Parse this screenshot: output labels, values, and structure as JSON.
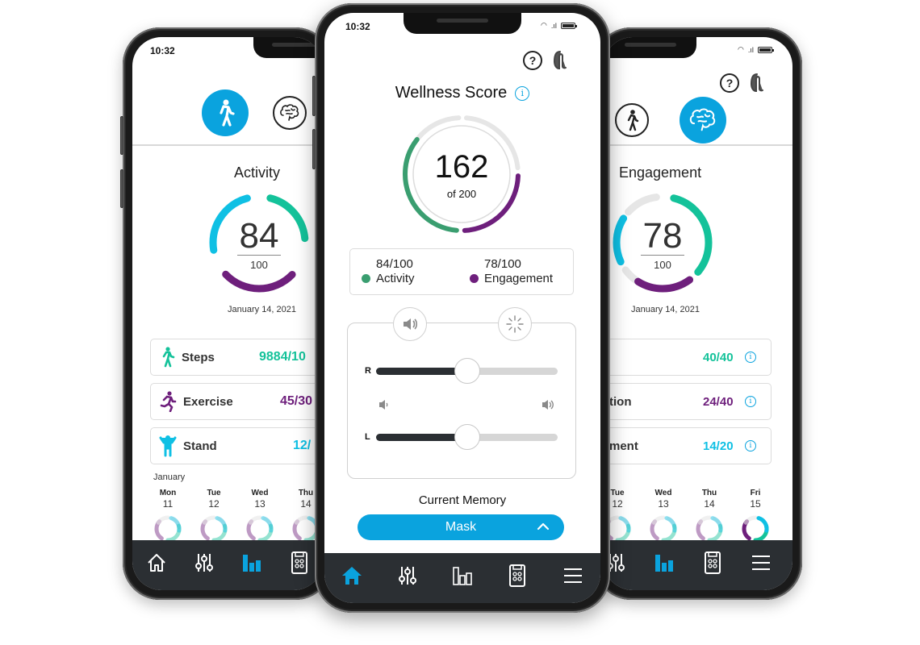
{
  "colors": {
    "accent_blue": "#0aa3de",
    "activity_green": "#3a9e70",
    "teal": "#14c29a",
    "cyan": "#0fc0e4",
    "purple": "#6e1f7c",
    "track_gray": "#e6e6e6",
    "nav_bg": "#2b2f33"
  },
  "status_bar": {
    "time": "10:32"
  },
  "icons": {
    "help": "help-bubble-icon",
    "hearing_aid": "hearing-aid-icon",
    "activity": "walking-person-icon",
    "engagement": "brain-icon",
    "info": "info-icon",
    "volume": "speaker-icon",
    "noise": "sparkle-icon"
  },
  "left_phone": {
    "title": "Activity",
    "score": "84",
    "total": "100",
    "date": "January 14, 2021",
    "ring": {
      "teal_fraction": 0.22,
      "cyan_fraction": 0.26,
      "purple_fraction": 0.28
    },
    "metrics": [
      {
        "label": "Steps",
        "value": "9884/10",
        "color": "#14c29a",
        "icon": "steps-icon"
      },
      {
        "label": "Exercise",
        "value": "45/30",
        "color": "#6e1f7c",
        "icon": "exercise-icon"
      },
      {
        "label": "Stand",
        "value": "12/",
        "color": "#0fc0e4",
        "icon": "stand-icon"
      }
    ],
    "month": "January",
    "days": [
      {
        "name": "Mon",
        "num": "11"
      },
      {
        "name": "Tue",
        "num": "12"
      },
      {
        "name": "Wed",
        "num": "13"
      },
      {
        "name": "Thu",
        "num": "14"
      }
    ]
  },
  "center_phone": {
    "title": "Wellness Score",
    "score": "162",
    "of_label": "of 200",
    "legend": [
      {
        "value": "84/100",
        "label": "Activity",
        "color": "#3a9e70"
      },
      {
        "value": "78/100",
        "label": "Engagement",
        "color": "#6e1f7c"
      }
    ],
    "sliders": [
      {
        "label": "R",
        "value_fraction": 0.5
      },
      {
        "label": "L",
        "value_fraction": 0.5
      }
    ],
    "memory_label": "Current Memory",
    "memory_value": "Mask"
  },
  "right_phone": {
    "title": "Engagement",
    "score": "78",
    "total": "100",
    "date": "January 14, 2021",
    "metrics": [
      {
        "label": "",
        "value": "40/40",
        "color": "#14c29a"
      },
      {
        "label": "tion",
        "value": "24/40",
        "color": "#6e1f7c"
      },
      {
        "label": "ment",
        "value": "14/20",
        "color": "#0fc0e4"
      }
    ],
    "days": [
      {
        "name": "Tue",
        "num": "12"
      },
      {
        "name": "Wed",
        "num": "13"
      },
      {
        "name": "Thu",
        "num": "14"
      },
      {
        "name": "Fri",
        "num": "15"
      }
    ]
  },
  "bottom_nav": {
    "items": [
      "home",
      "adjustments",
      "stats",
      "remote",
      "menu"
    ],
    "center_active": "home",
    "side_active": "stats"
  }
}
